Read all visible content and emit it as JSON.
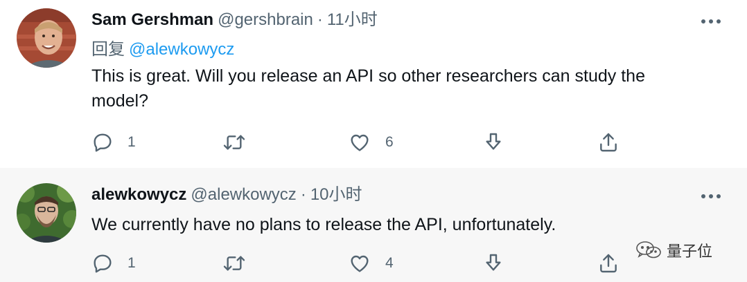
{
  "tweets": [
    {
      "name": "Sam Gershman",
      "handle": "@gershbrain",
      "dot": "·",
      "time": "11小时",
      "reply_label": "回复",
      "reply_mention": "@alewkowycz",
      "text": "This is great. Will you release an API so other researchers can study the model?",
      "reply_count": "1",
      "like_count": "6"
    },
    {
      "name": "alewkowycz",
      "handle": "@alewkowycz",
      "dot": "·",
      "time": "10小时",
      "text": "We currently have no plans to release the API, unfortunately.",
      "reply_count": "1",
      "like_count": "4"
    }
  ],
  "icons": {
    "reply": "reply-icon",
    "retweet": "retweet-icon",
    "like": "heart-icon",
    "download": "download-icon",
    "share": "share-icon",
    "more": "more-icon"
  },
  "watermark": {
    "text": "量子位"
  },
  "colors": {
    "link": "#1d9bf0",
    "secondary_text": "#536471",
    "thread_line": "#cfd9de",
    "second_tweet_background": "#f7f7f7"
  }
}
